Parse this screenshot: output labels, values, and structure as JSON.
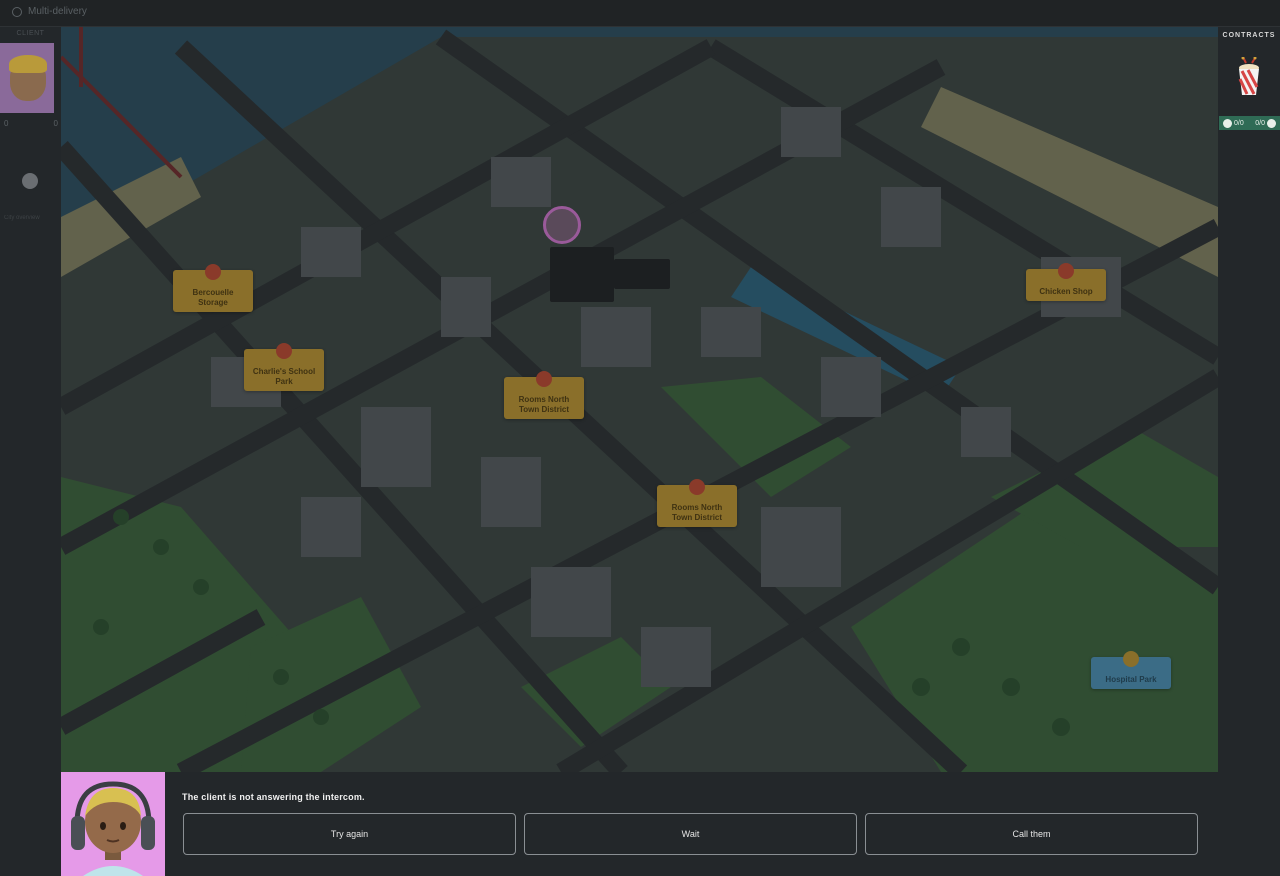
{
  "window": {
    "title": "Multi-delivery"
  },
  "left_sidebar": {
    "label": "CLIENT",
    "stats": [
      "0",
      "0"
    ],
    "tiny_text": "City overview"
  },
  "map": {
    "labels": [
      {
        "id": "cycle-storage",
        "text": "Bercouelle Storage",
        "color": "orange"
      },
      {
        "id": "charlies-school",
        "text": "Charlie's School Park",
        "color": "orange"
      },
      {
        "id": "rooms-a",
        "text": "Rooms North Town District",
        "color": "orange"
      },
      {
        "id": "rooms-b",
        "text": "Rooms North Town District",
        "color": "orange"
      },
      {
        "id": "chicken-shop",
        "text": "Chicken Shop",
        "color": "orange"
      },
      {
        "id": "hospital",
        "text": "Hospital Park",
        "color": "blue"
      }
    ]
  },
  "right_sidebar": {
    "title": "CONTRACTS",
    "counter_left": "0/0",
    "counter_right": "0/0",
    "contract_icon": "popcorn-bucket-icon"
  },
  "dialog": {
    "message": "The client is not answering the intercom.",
    "choices": [
      {
        "label": "Try again"
      },
      {
        "label": "Wait"
      },
      {
        "label": "Call them"
      }
    ]
  },
  "colors": {
    "accent_green": "#2f6b55",
    "portrait_bg": "#e59ae8",
    "button_border": "#8a8f93"
  }
}
